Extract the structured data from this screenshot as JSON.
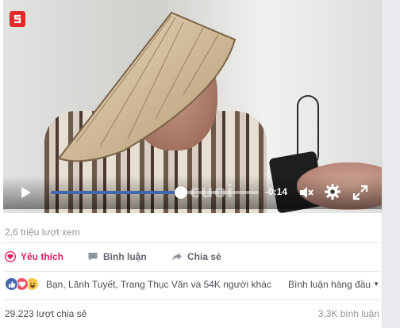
{
  "video": {
    "time_remaining": "-0:14",
    "progress": 0.625,
    "watermark_text": "cuoi",
    "logo_icon": "channel-logo-icon",
    "accent_color": "#4267b2"
  },
  "stats": {
    "views": "2,6 triệu lượt xem"
  },
  "actions": {
    "like_label": "Yêu thích",
    "comment_label": "Bình luận",
    "share_label": "Chia sẻ",
    "like_color": "#e0245e"
  },
  "reactions": {
    "icons": [
      "like-reaction-icon",
      "love-reaction-icon",
      "haha-reaction-icon"
    ],
    "names_text": "Bạn, Lãnh Tuyết, Trang Thục Văn và 54K người khác",
    "sort_label": "Bình luận hàng đầu"
  },
  "footer": {
    "shares_text": "29.223 lượt chia sẻ",
    "comments_text": "3,3K bình luận"
  }
}
